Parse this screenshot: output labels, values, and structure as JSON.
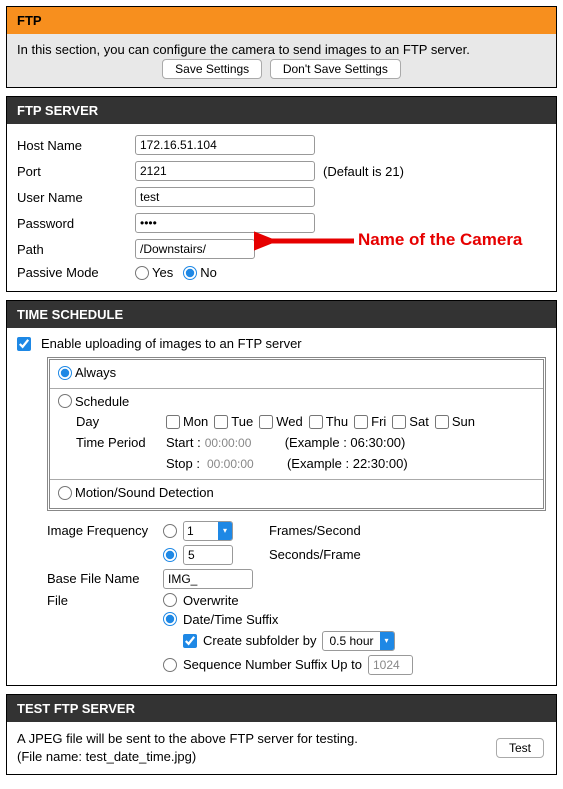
{
  "ftp": {
    "title": "FTP",
    "desc": "In this section, you can configure the camera to send images to an FTP server.",
    "save_btn": "Save Settings",
    "dont_save_btn": "Don't Save Settings"
  },
  "server": {
    "title": "FTP SERVER",
    "host_label": "Host Name",
    "host_value": "172.16.51.104",
    "port_label": "Port",
    "port_value": "2121",
    "port_hint": "(Default is 21)",
    "user_label": "User Name",
    "user_value": "test",
    "pass_label": "Password",
    "pass_value": "••••",
    "path_label": "Path",
    "path_value": "/Downstairs/",
    "passive_label": "Passive Mode",
    "passive_yes": "Yes",
    "passive_no": "No"
  },
  "schedule": {
    "title": "TIME SCHEDULE",
    "enable_label": "Enable uploading of images to an FTP server",
    "always_label": "Always",
    "schedule_label": "Schedule",
    "day_label": "Day",
    "days": [
      "Mon",
      "Tue",
      "Wed",
      "Thu",
      "Fri",
      "Sat",
      "Sun"
    ],
    "time_period_label": "Time Period",
    "start_label": "Start :",
    "start_value": "00:00:00",
    "start_example": "(Example : 06:30:00)",
    "stop_label": "Stop :",
    "stop_value": "00:00:00",
    "stop_example": "(Example : 22:30:00)",
    "motion_label": "Motion/Sound Detection"
  },
  "freq": {
    "image_freq_label": "Image Frequency",
    "fps_value": "1",
    "fps_label": "Frames/Second",
    "spf_value": "5",
    "spf_label": "Seconds/Frame",
    "basefile_label": "Base File Name",
    "basefile_value": "IMG_",
    "file_label": "File",
    "overwrite_label": "Overwrite",
    "datetime_label": "Date/Time Suffix",
    "create_sub_label": "Create subfolder by",
    "sub_interval": "0.5 hour",
    "sequence_label": "Sequence Number Suffix Up to",
    "sequence_value": "1024"
  },
  "test": {
    "title": "TEST FTP SERVER",
    "desc1": "A JPEG file will be sent to the above FTP server for testing.",
    "desc2": "(File name: test_date_time.jpg)",
    "test_btn": "Test"
  },
  "annotation": {
    "callout": "Name of the Camera"
  }
}
